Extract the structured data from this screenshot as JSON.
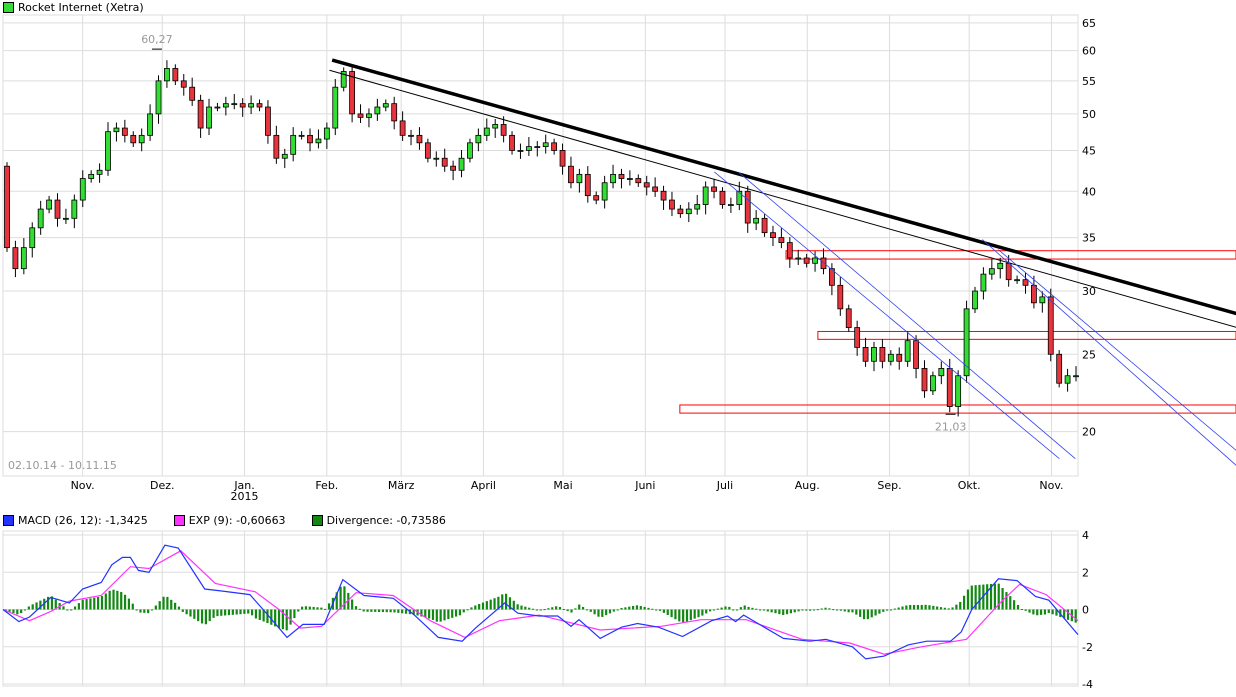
{
  "title": {
    "label": "Rocket Internet (Xetra)",
    "color": "#33dd33"
  },
  "date_range": "02.10.14 - 10.11.15",
  "colors": {
    "up": "#33dd33",
    "down": "#e8343c",
    "grid": "#dddddd",
    "zone": "#ff0000",
    "channel": "#3344ee",
    "macd": "#2233ff",
    "signal": "#ff33ff",
    "divergence": "#118811"
  },
  "chart_data": [
    {
      "type": "candlestick",
      "title": "Rocket Internet (Xetra)",
      "scale": "log",
      "xlim_days": [
        0,
        405
      ],
      "ylim": [
        17.6,
        66.5
      ],
      "yticks": [
        20,
        25,
        30,
        35,
        40,
        45,
        50,
        55,
        60,
        65
      ],
      "grid": true,
      "months": [
        {
          "label": "Nov.",
          "day": 30
        },
        {
          "label": "Dez.",
          "day": 60
        },
        {
          "label": "Jan.",
          "sub": "2015",
          "day": 91
        },
        {
          "label": "Feb.",
          "day": 122
        },
        {
          "label": "März",
          "day": 150
        },
        {
          "label": "April",
          "day": 181
        },
        {
          "label": "Mai",
          "day": 211
        },
        {
          "label": "Juni",
          "day": 242
        },
        {
          "label": "Juli",
          "day": 272
        },
        {
          "label": "Aug.",
          "day": 303
        },
        {
          "label": "Sep.",
          "day": 334
        },
        {
          "label": "Okt.",
          "day": 364
        },
        {
          "label": "Nov.",
          "day": 395
        }
      ],
      "first_open": 43,
      "closes": [
        34,
        32,
        34,
        36,
        38,
        39,
        37,
        37,
        39,
        41.5,
        42,
        42.5,
        47.5,
        48,
        47,
        46,
        47,
        50,
        55,
        57,
        55,
        54,
        52,
        48,
        51,
        51,
        51.5,
        51.5,
        51,
        51.5,
        51,
        47,
        44,
        44.5,
        47,
        47,
        46,
        46.5,
        48,
        54,
        56.5,
        50,
        49.5,
        50,
        51,
        51.5,
        49,
        47,
        47,
        46,
        44,
        44,
        43,
        42.5,
        44,
        46,
        47,
        48,
        48.5,
        47,
        45,
        45,
        45.5,
        45.5,
        46,
        45,
        43,
        41,
        42,
        39.5,
        39,
        41,
        42,
        41.5,
        41.5,
        41,
        40.5,
        40,
        39,
        38,
        37.5,
        38,
        38.5,
        40.5,
        40,
        38.5,
        38.5,
        40,
        36.5,
        37,
        35.5,
        35,
        34.5,
        33,
        33,
        32.5,
        33,
        32,
        30.5,
        28.5,
        27,
        25.5,
        24.5,
        25.5,
        24.5,
        25,
        24.5,
        26,
        24,
        22.5,
        23.5,
        24,
        21.5,
        23.5,
        28.5,
        30,
        31.5,
        32,
        32.5,
        31,
        31,
        30.5,
        29,
        29.5,
        25,
        23,
        23.5,
        23.5
      ],
      "annotations": [
        {
          "text": "60,27",
          "day": 58,
          "price": 60.27
        },
        {
          "text": "21,03",
          "day": 357,
          "price": 21.03
        }
      ],
      "trendlines": [
        {
          "kind": "thick",
          "from": [
            124,
            58.4
          ],
          "to": [
            465,
            28.1
          ]
        },
        {
          "kind": "thin",
          "from": [
            123,
            56.7
          ],
          "to": [
            465,
            27.0
          ]
        },
        {
          "kind": "channel",
          "from": [
            268,
            42.3
          ],
          "to": [
            398,
            18.5
          ]
        },
        {
          "kind": "channel",
          "from": [
            277,
            42.3
          ],
          "to": [
            404,
            18.5
          ]
        },
        {
          "kind": "channel",
          "from": [
            369,
            34.8
          ],
          "to": [
            465,
            18.1
          ]
        },
        {
          "kind": "channel",
          "from": [
            375,
            33.8
          ],
          "to": [
            465,
            18.9
          ]
        }
      ],
      "zones": [
        {
          "from_day": 295,
          "top": 33.7,
          "bottom": 32.9
        },
        {
          "from_day": 307,
          "top": 26.7,
          "bottom": 26.1
        },
        {
          "from_day": 255,
          "top": 21.6,
          "bottom": 21.1
        }
      ]
    },
    {
      "type": "line",
      "title": "MACD",
      "ylim": [
        -4,
        4
      ],
      "yticks": [
        4,
        2,
        0,
        -2,
        -4
      ],
      "legend": [
        {
          "label": "MACD (26, 12): -1,3425",
          "color_key": "macd"
        },
        {
          "label": "EXP (9): -0,60663",
          "color_key": "signal"
        },
        {
          "label": "Divergence: -0,73586",
          "color_key": "divergence"
        }
      ],
      "macd": [
        [
          0,
          0
        ],
        [
          6,
          -0.65
        ],
        [
          10,
          -0.4
        ],
        [
          18,
          0.65
        ],
        [
          25,
          0.35
        ],
        [
          30,
          1.1
        ],
        [
          37,
          1.45
        ],
        [
          41,
          2.4
        ],
        [
          45,
          2.8
        ],
        [
          48,
          2.8
        ],
        [
          51,
          2.1
        ],
        [
          55,
          2.0
        ],
        [
          61,
          3.45
        ],
        [
          66,
          3.3
        ],
        [
          76,
          1.1
        ],
        [
          82,
          1.0
        ],
        [
          93,
          0.8
        ],
        [
          98,
          0
        ],
        [
          107,
          -1.5
        ],
        [
          113,
          -0.8
        ],
        [
          121,
          -0.8
        ],
        [
          128,
          1.6
        ],
        [
          136,
          0.75
        ],
        [
          147,
          0.6
        ],
        [
          155,
          -0.3
        ],
        [
          164,
          -1.5
        ],
        [
          173,
          -1.7
        ],
        [
          178,
          -1.0
        ],
        [
          189,
          0.35
        ],
        [
          194,
          -0.2
        ],
        [
          202,
          -0.35
        ],
        [
          209,
          -0.35
        ],
        [
          214,
          -0.9
        ],
        [
          217,
          -0.55
        ],
        [
          225,
          -1.55
        ],
        [
          233,
          -0.95
        ],
        [
          239,
          -0.75
        ],
        [
          247,
          -0.95
        ],
        [
          256,
          -1.45
        ],
        [
          267,
          -0.6
        ],
        [
          273,
          -0.35
        ],
        [
          276,
          -0.65
        ],
        [
          279,
          -0.3
        ],
        [
          294,
          -1.55
        ],
        [
          304,
          -1.7
        ],
        [
          310,
          -1.6
        ],
        [
          320,
          -2.0
        ],
        [
          325,
          -2.65
        ],
        [
          332,
          -2.5
        ],
        [
          341,
          -1.9
        ],
        [
          348,
          -1.7
        ],
        [
          357,
          -1.7
        ],
        [
          361,
          -1.2
        ],
        [
          365,
          0.0
        ],
        [
          375,
          1.65
        ],
        [
          382,
          1.55
        ],
        [
          389,
          0.7
        ],
        [
          394,
          0.5
        ],
        [
          405,
          -1.35
        ]
      ],
      "signal": [
        [
          0,
          0
        ],
        [
          10,
          -0.6
        ],
        [
          18,
          -0.1
        ],
        [
          25,
          0.45
        ],
        [
          37,
          0.75
        ],
        [
          48,
          2.3
        ],
        [
          55,
          2.2
        ],
        [
          67,
          3.15
        ],
        [
          80,
          1.4
        ],
        [
          95,
          0.95
        ],
        [
          104,
          0.0
        ],
        [
          112,
          -1.0
        ],
        [
          120,
          -0.9
        ],
        [
          133,
          0.9
        ],
        [
          147,
          0.75
        ],
        [
          161,
          -0.6
        ],
        [
          174,
          -1.5
        ],
        [
          187,
          -0.6
        ],
        [
          202,
          -0.3
        ],
        [
          225,
          -1.1
        ],
        [
          248,
          -0.9
        ],
        [
          263,
          -0.55
        ],
        [
          280,
          -0.55
        ],
        [
          301,
          -1.6
        ],
        [
          319,
          -1.8
        ],
        [
          332,
          -2.4
        ],
        [
          346,
          -2.0
        ],
        [
          363,
          -1.6
        ],
        [
          376,
          0.4
        ],
        [
          383,
          1.35
        ],
        [
          393,
          0.8
        ],
        [
          405,
          -0.6
        ]
      ]
    }
  ]
}
